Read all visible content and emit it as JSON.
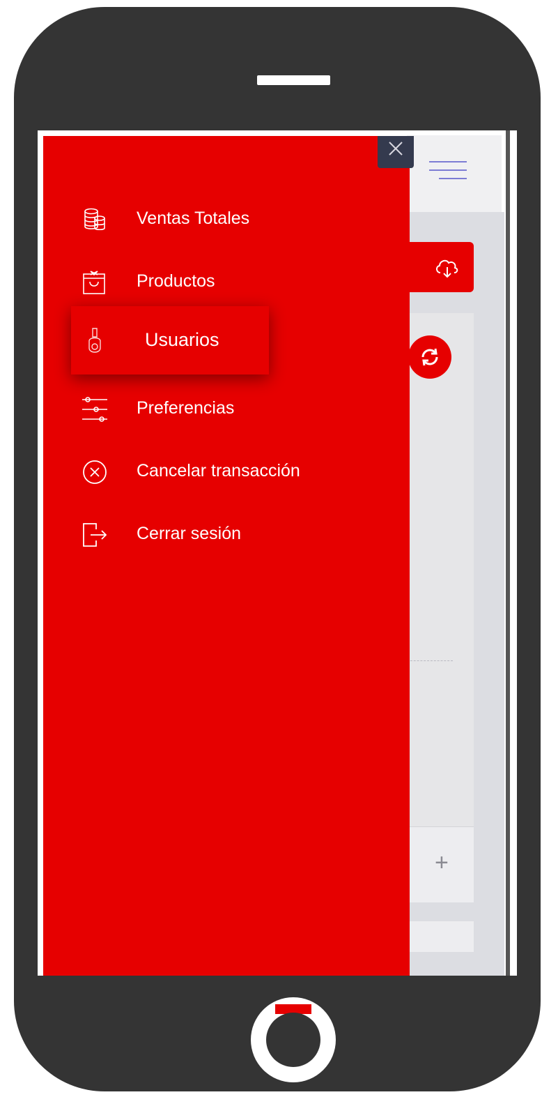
{
  "drawer": {
    "close_label": "×",
    "items": [
      {
        "label": "Ventas Totales",
        "icon": "coins-icon"
      },
      {
        "label": "Productos",
        "icon": "shopping-bag-icon"
      },
      {
        "label": "Usuarios",
        "icon": "user-icon",
        "active": true
      },
      {
        "label": "Preferencias",
        "icon": "sliders-icon"
      },
      {
        "label": "Cancelar transacción",
        "icon": "cancel-circle-icon"
      },
      {
        "label": "Cerrar sesión",
        "icon": "logout-icon"
      }
    ]
  },
  "app": {
    "plus_label": "+"
  },
  "colors": {
    "accent": "#e60000",
    "phone": "#343434",
    "close_button": "#343a4e"
  }
}
